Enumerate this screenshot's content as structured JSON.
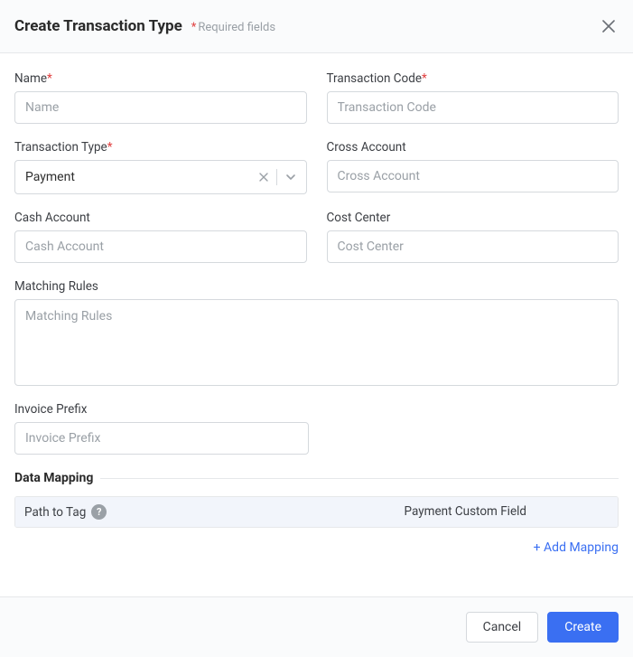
{
  "header": {
    "title": "Create Transaction Type",
    "required_hint": "Required fields"
  },
  "fields": {
    "name": {
      "label": "Name",
      "placeholder": "Name",
      "required": true
    },
    "transaction_code": {
      "label": "Transaction Code",
      "placeholder": "Transaction Code",
      "required": true
    },
    "transaction_type": {
      "label": "Transaction Type",
      "value": "Payment",
      "required": true
    },
    "cross_account": {
      "label": "Cross Account",
      "placeholder": "Cross Account"
    },
    "cash_account": {
      "label": "Cash Account",
      "placeholder": "Cash Account"
    },
    "cost_center": {
      "label": "Cost Center",
      "placeholder": "Cost Center"
    },
    "matching_rules": {
      "label": "Matching Rules",
      "placeholder": "Matching Rules"
    },
    "invoice_prefix": {
      "label": "Invoice Prefix",
      "placeholder": "Invoice Prefix"
    }
  },
  "data_mapping": {
    "section_title": "Data Mapping",
    "columns": {
      "path": "Path to Tag",
      "field": "Payment Custom Field"
    },
    "add_label": "+ Add Mapping"
  },
  "footer": {
    "cancel": "Cancel",
    "create": "Create"
  }
}
